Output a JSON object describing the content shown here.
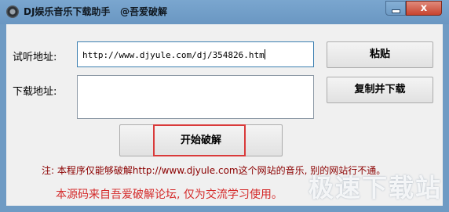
{
  "window": {
    "title": "DJ娱乐音乐下载助手   @吾爱破解",
    "close_glyph": "x"
  },
  "form": {
    "listen_label": "试听地址:",
    "listen_value": "http://www.djyule.com/dj/354826.htm",
    "download_label": "下载地址:",
    "download_value": ""
  },
  "buttons": {
    "paste": "粘贴",
    "copy_download": "复制并下载",
    "start_crack": "开始破解"
  },
  "notes": {
    "note1": "注: 本程序仅能够破解http://www.djyule.com这个网站的音乐, 别的网站行不通。",
    "note2": "本源码来自吾爱破解论坛, 仅为交流学习使用。"
  },
  "watermark": "极速下载站",
  "colors": {
    "titlebar": "#6f9bc4",
    "highlight_border": "#d93a3a",
    "note_text": "#8b0000",
    "source_note_text": "#d42a2a"
  }
}
